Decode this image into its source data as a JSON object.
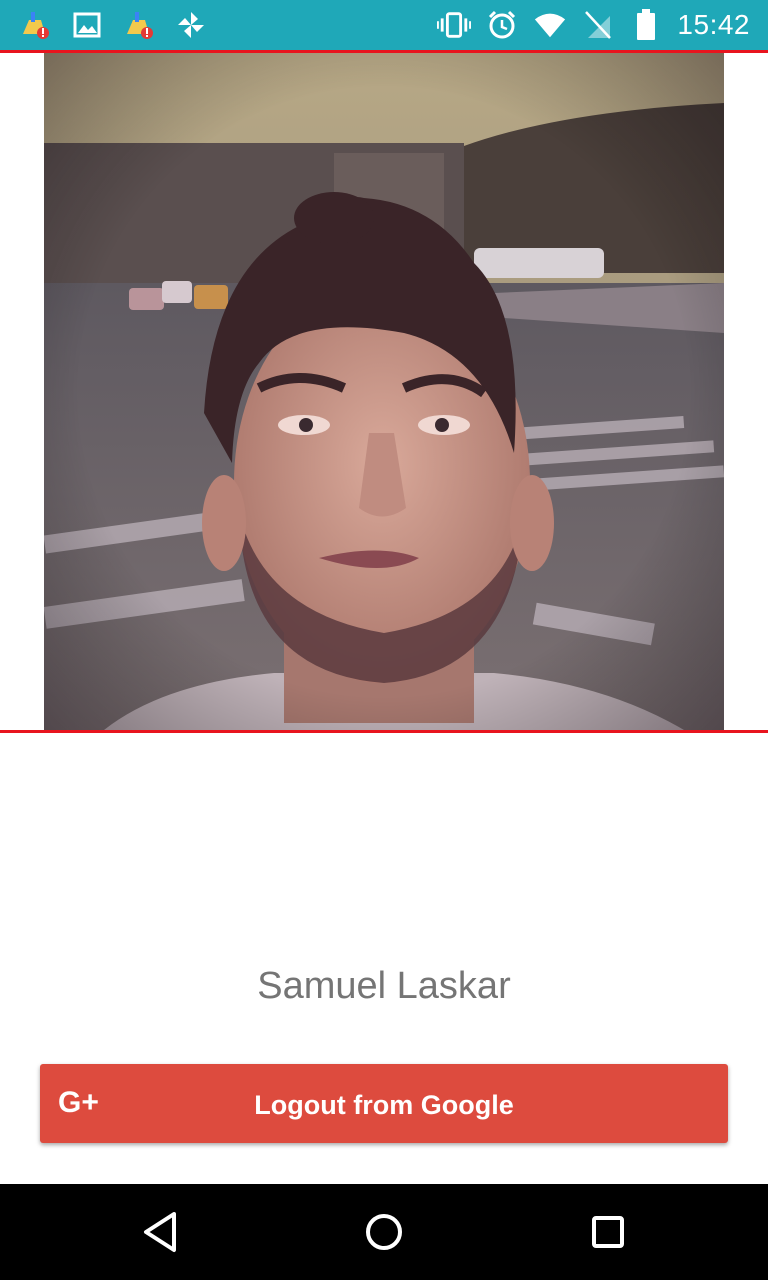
{
  "status_bar": {
    "time": "15:42",
    "left_icons": [
      "cleaner-alert-icon",
      "image-icon",
      "cleaner-alert-icon",
      "pinwheel-icon"
    ],
    "right_icons": [
      "vibrate-icon",
      "alarm-icon",
      "wifi-icon",
      "no-sim-icon",
      "battery-icon"
    ]
  },
  "profile": {
    "name": "Samuel Laskar"
  },
  "logout_button": {
    "icon_label": "G+",
    "label": "Logout from Google"
  },
  "nav_bar": {
    "buttons": [
      "back",
      "home",
      "recents"
    ]
  },
  "colors": {
    "status_bar": "#1fa8b8",
    "accent_line": "#e8141e",
    "google_red": "#dd4b3e",
    "name_text": "#757575"
  }
}
